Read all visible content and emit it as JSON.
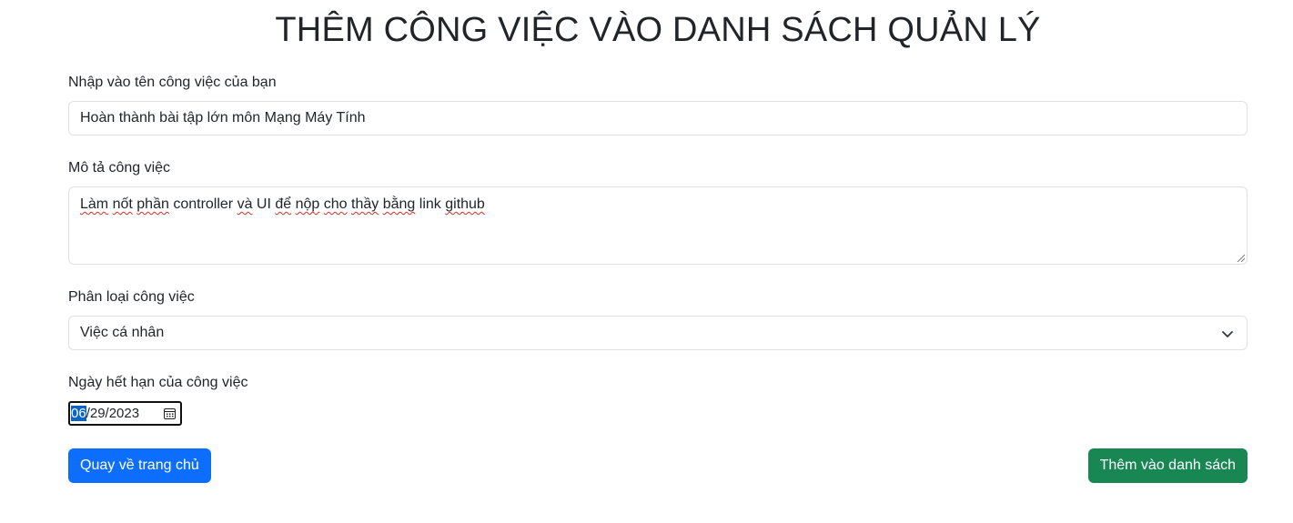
{
  "page_title": "THÊM CÔNG VIỆC VÀO DANH SÁCH QUẢN LÝ",
  "form": {
    "name": {
      "label": "Nhập vào tên công việc của bạn",
      "value": "Hoàn thành bài tập lớn môn Mạng Máy Tính"
    },
    "description": {
      "label": "Mô tả công việc",
      "segments": [
        "Làm",
        " ",
        "nốt",
        " ",
        "phần",
        " controller ",
        "và",
        " UI ",
        "để",
        " ",
        "nộp",
        " ",
        "cho",
        " ",
        "thầy",
        " ",
        "bằng",
        " link ",
        "github"
      ]
    },
    "category": {
      "label": "Phân loại công việc",
      "value": "Việc cá nhân"
    },
    "due_date": {
      "label": "Ngày hết hạn của công việc",
      "month": "06",
      "rest": "/29/2023"
    }
  },
  "buttons": {
    "back": "Quay về trang chủ",
    "add": "Thêm vào danh sách"
  },
  "icons": {
    "select_chevron": "chevron-down-icon",
    "date_picker": "calendar-icon"
  },
  "colors": {
    "primary": "#0d6efd",
    "success": "#198754",
    "date_selection": "#0a64c8"
  }
}
